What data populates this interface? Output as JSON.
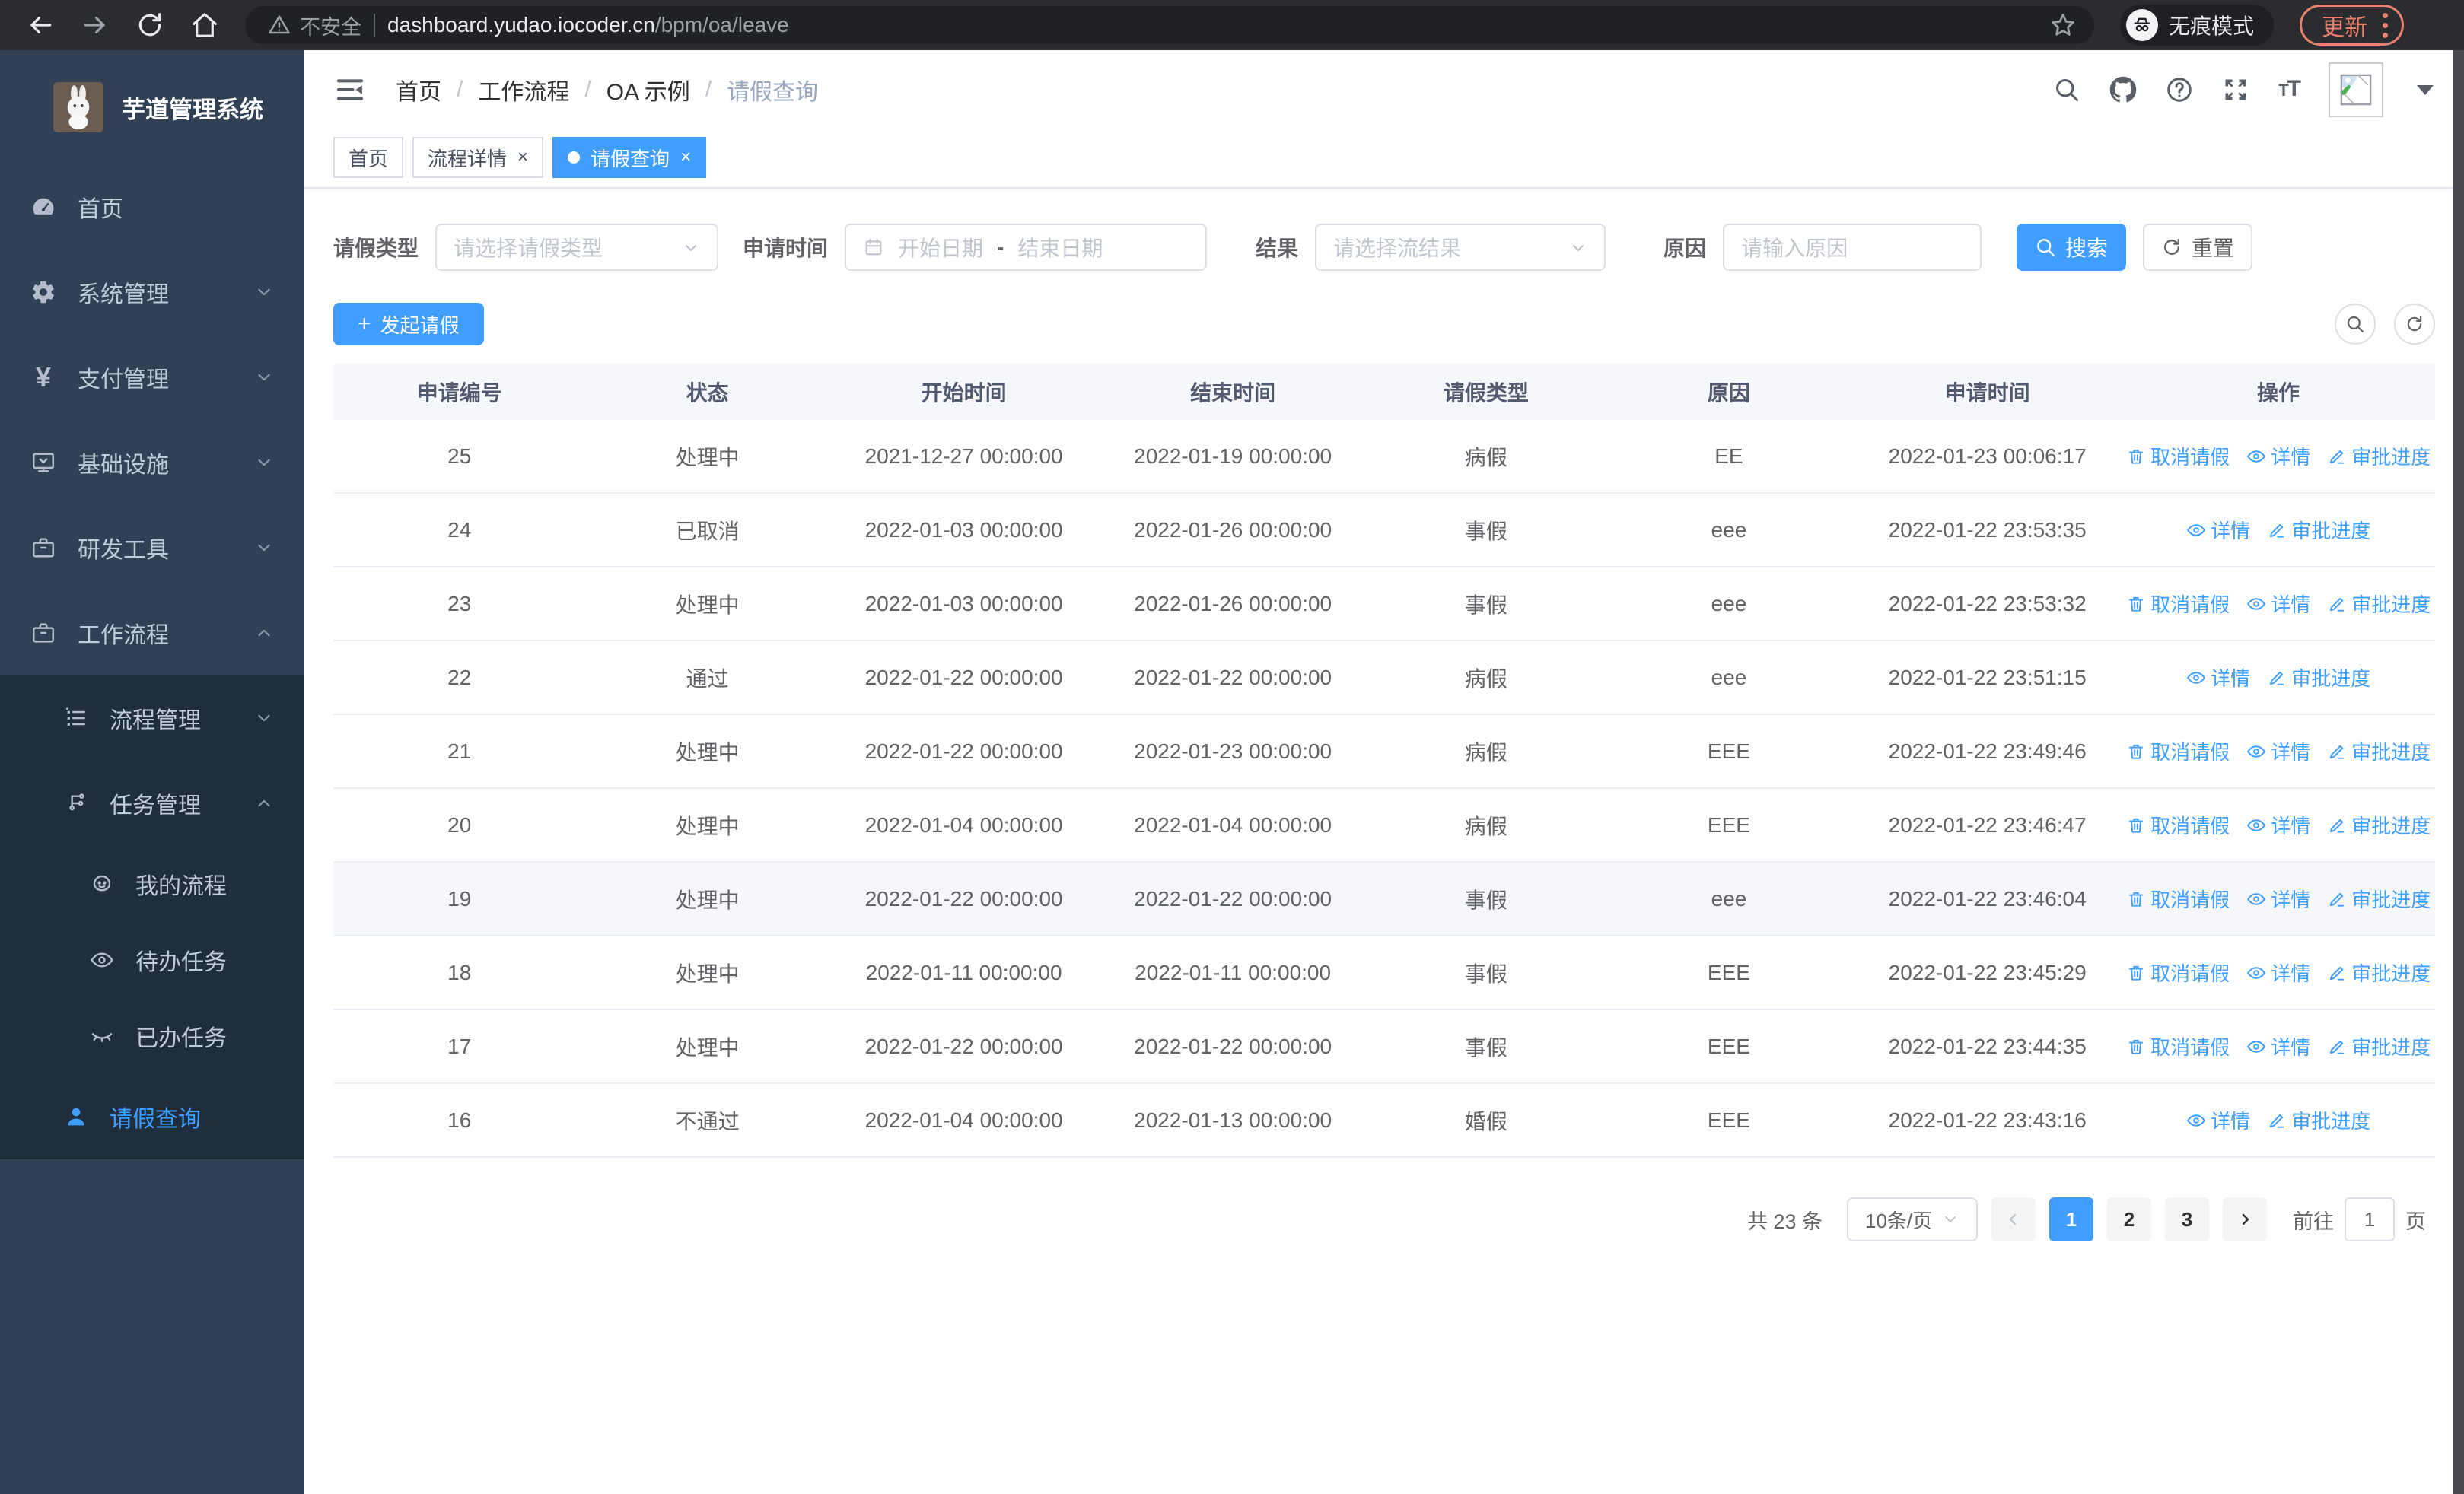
{
  "browser": {
    "security_label": "不安全",
    "url_host": "dashboard.yudao.iocoder.cn",
    "url_path": "/bpm/oa/leave",
    "incognito_label": "无痕模式",
    "update_label": "更新"
  },
  "colors": {
    "primary": "#409EFF",
    "sidebar_bg": "#304156",
    "submenu_bg": "#1f2d3d",
    "update_accent": "#e8826d"
  },
  "sidebar": {
    "app_title": "芋道管理系统",
    "home": "首页",
    "system": "系统管理",
    "pay": "支付管理",
    "infra": "基础设施",
    "dev": "研发工具",
    "workflow": "工作流程",
    "process_mgmt": "流程管理",
    "task_mgmt": "任务管理",
    "my_process": "我的流程",
    "todo_tasks": "待办任务",
    "done_tasks": "已办任务",
    "leave_query": "请假查询"
  },
  "header": {
    "breadcrumb": [
      "首页",
      "工作流程",
      "OA 示例",
      "请假查询"
    ]
  },
  "tabs": {
    "home": "首页",
    "detail": "流程详情",
    "leave": "请假查询"
  },
  "filters": {
    "type_label": "请假类型",
    "type_placeholder": "请选择请假类型",
    "time_label": "申请时间",
    "start_placeholder": "开始日期",
    "range_separator": "-",
    "end_placeholder": "结束日期",
    "result_label": "结果",
    "result_placeholder": "请选择流结果",
    "reason_label": "原因",
    "reason_placeholder": "请输入原因",
    "search_label": "搜索",
    "reset_label": "重置"
  },
  "toolbar": {
    "create_label": "发起请假"
  },
  "table": {
    "columns": [
      "申请编号",
      "状态",
      "开始时间",
      "结束时间",
      "请假类型",
      "原因",
      "申请时间",
      "操作"
    ],
    "action_labels": {
      "cancel": "取消请假",
      "detail": "详情",
      "progress": "审批进度"
    },
    "rows": [
      {
        "id": "25",
        "status": "处理中",
        "start": "2021-12-27 00:00:00",
        "end": "2022-01-19 00:00:00",
        "type": "病假",
        "reason": "EE",
        "applied": "2022-01-23 00:06:17",
        "actions": [
          "cancel",
          "detail",
          "progress"
        ],
        "highlight": false
      },
      {
        "id": "24",
        "status": "已取消",
        "start": "2022-01-03 00:00:00",
        "end": "2022-01-26 00:00:00",
        "type": "事假",
        "reason": "eee",
        "applied": "2022-01-22 23:53:35",
        "actions": [
          "detail",
          "progress"
        ],
        "highlight": false
      },
      {
        "id": "23",
        "status": "处理中",
        "start": "2022-01-03 00:00:00",
        "end": "2022-01-26 00:00:00",
        "type": "事假",
        "reason": "eee",
        "applied": "2022-01-22 23:53:32",
        "actions": [
          "cancel",
          "detail",
          "progress"
        ],
        "highlight": false
      },
      {
        "id": "22",
        "status": "通过",
        "start": "2022-01-22 00:00:00",
        "end": "2022-01-22 00:00:00",
        "type": "病假",
        "reason": "eee",
        "applied": "2022-01-22 23:51:15",
        "actions": [
          "detail",
          "progress"
        ],
        "highlight": false
      },
      {
        "id": "21",
        "status": "处理中",
        "start": "2022-01-22 00:00:00",
        "end": "2022-01-23 00:00:00",
        "type": "病假",
        "reason": "EEE",
        "applied": "2022-01-22 23:49:46",
        "actions": [
          "cancel",
          "detail",
          "progress"
        ],
        "highlight": false
      },
      {
        "id": "20",
        "status": "处理中",
        "start": "2022-01-04 00:00:00",
        "end": "2022-01-04 00:00:00",
        "type": "病假",
        "reason": "EEE",
        "applied": "2022-01-22 23:46:47",
        "actions": [
          "cancel",
          "detail",
          "progress"
        ],
        "highlight": false
      },
      {
        "id": "19",
        "status": "处理中",
        "start": "2022-01-22 00:00:00",
        "end": "2022-01-22 00:00:00",
        "type": "事假",
        "reason": "eee",
        "applied": "2022-01-22 23:46:04",
        "actions": [
          "cancel",
          "detail",
          "progress"
        ],
        "highlight": true
      },
      {
        "id": "18",
        "status": "处理中",
        "start": "2022-01-11 00:00:00",
        "end": "2022-01-11 00:00:00",
        "type": "事假",
        "reason": "EEE",
        "applied": "2022-01-22 23:45:29",
        "actions": [
          "cancel",
          "detail",
          "progress"
        ],
        "highlight": false
      },
      {
        "id": "17",
        "status": "处理中",
        "start": "2022-01-22 00:00:00",
        "end": "2022-01-22 00:00:00",
        "type": "事假",
        "reason": "EEE",
        "applied": "2022-01-22 23:44:35",
        "actions": [
          "cancel",
          "detail",
          "progress"
        ],
        "highlight": false
      },
      {
        "id": "16",
        "status": "不通过",
        "start": "2022-01-04 00:00:00",
        "end": "2022-01-13 00:00:00",
        "type": "婚假",
        "reason": "EEE",
        "applied": "2022-01-22 23:43:16",
        "actions": [
          "detail",
          "progress"
        ],
        "highlight": false
      }
    ]
  },
  "pagination": {
    "total_text": "共 23 条",
    "page_size": "10条/页",
    "pages": [
      "1",
      "2",
      "3"
    ],
    "active_page": "1",
    "goto_label": "前往",
    "goto_value": "1",
    "page_unit": "页"
  }
}
